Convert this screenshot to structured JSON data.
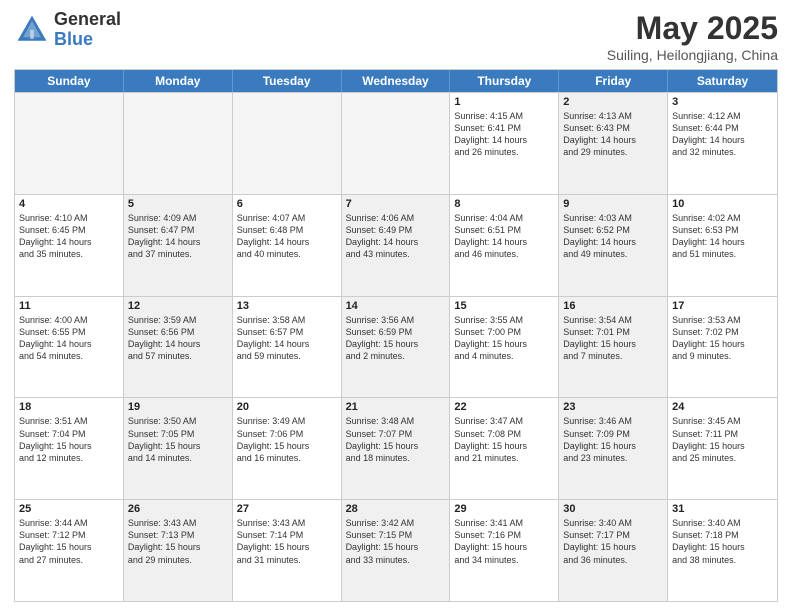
{
  "header": {
    "logo_general": "General",
    "logo_blue": "Blue",
    "month": "May 2025",
    "location": "Suiling, Heilongjiang, China"
  },
  "weekdays": [
    "Sunday",
    "Monday",
    "Tuesday",
    "Wednesday",
    "Thursday",
    "Friday",
    "Saturday"
  ],
  "weeks": [
    [
      {
        "day": "",
        "info": "",
        "empty": true
      },
      {
        "day": "",
        "info": "",
        "empty": true
      },
      {
        "day": "",
        "info": "",
        "empty": true
      },
      {
        "day": "",
        "info": "",
        "empty": true
      },
      {
        "day": "1",
        "info": "Sunrise: 4:15 AM\nSunset: 6:41 PM\nDaylight: 14 hours\nand 26 minutes."
      },
      {
        "day": "2",
        "info": "Sunrise: 4:13 AM\nSunset: 6:43 PM\nDaylight: 14 hours\nand 29 minutes.",
        "shaded": true
      },
      {
        "day": "3",
        "info": "Sunrise: 4:12 AM\nSunset: 6:44 PM\nDaylight: 14 hours\nand 32 minutes."
      }
    ],
    [
      {
        "day": "4",
        "info": "Sunrise: 4:10 AM\nSunset: 6:45 PM\nDaylight: 14 hours\nand 35 minutes."
      },
      {
        "day": "5",
        "info": "Sunrise: 4:09 AM\nSunset: 6:47 PM\nDaylight: 14 hours\nand 37 minutes.",
        "shaded": true
      },
      {
        "day": "6",
        "info": "Sunrise: 4:07 AM\nSunset: 6:48 PM\nDaylight: 14 hours\nand 40 minutes."
      },
      {
        "day": "7",
        "info": "Sunrise: 4:06 AM\nSunset: 6:49 PM\nDaylight: 14 hours\nand 43 minutes.",
        "shaded": true
      },
      {
        "day": "8",
        "info": "Sunrise: 4:04 AM\nSunset: 6:51 PM\nDaylight: 14 hours\nand 46 minutes."
      },
      {
        "day": "9",
        "info": "Sunrise: 4:03 AM\nSunset: 6:52 PM\nDaylight: 14 hours\nand 49 minutes.",
        "shaded": true
      },
      {
        "day": "10",
        "info": "Sunrise: 4:02 AM\nSunset: 6:53 PM\nDaylight: 14 hours\nand 51 minutes."
      }
    ],
    [
      {
        "day": "11",
        "info": "Sunrise: 4:00 AM\nSunset: 6:55 PM\nDaylight: 14 hours\nand 54 minutes."
      },
      {
        "day": "12",
        "info": "Sunrise: 3:59 AM\nSunset: 6:56 PM\nDaylight: 14 hours\nand 57 minutes.",
        "shaded": true
      },
      {
        "day": "13",
        "info": "Sunrise: 3:58 AM\nSunset: 6:57 PM\nDaylight: 14 hours\nand 59 minutes."
      },
      {
        "day": "14",
        "info": "Sunrise: 3:56 AM\nSunset: 6:59 PM\nDaylight: 15 hours\nand 2 minutes.",
        "shaded": true
      },
      {
        "day": "15",
        "info": "Sunrise: 3:55 AM\nSunset: 7:00 PM\nDaylight: 15 hours\nand 4 minutes."
      },
      {
        "day": "16",
        "info": "Sunrise: 3:54 AM\nSunset: 7:01 PM\nDaylight: 15 hours\nand 7 minutes.",
        "shaded": true
      },
      {
        "day": "17",
        "info": "Sunrise: 3:53 AM\nSunset: 7:02 PM\nDaylight: 15 hours\nand 9 minutes."
      }
    ],
    [
      {
        "day": "18",
        "info": "Sunrise: 3:51 AM\nSunset: 7:04 PM\nDaylight: 15 hours\nand 12 minutes."
      },
      {
        "day": "19",
        "info": "Sunrise: 3:50 AM\nSunset: 7:05 PM\nDaylight: 15 hours\nand 14 minutes.",
        "shaded": true
      },
      {
        "day": "20",
        "info": "Sunrise: 3:49 AM\nSunset: 7:06 PM\nDaylight: 15 hours\nand 16 minutes."
      },
      {
        "day": "21",
        "info": "Sunrise: 3:48 AM\nSunset: 7:07 PM\nDaylight: 15 hours\nand 18 minutes.",
        "shaded": true
      },
      {
        "day": "22",
        "info": "Sunrise: 3:47 AM\nSunset: 7:08 PM\nDaylight: 15 hours\nand 21 minutes."
      },
      {
        "day": "23",
        "info": "Sunrise: 3:46 AM\nSunset: 7:09 PM\nDaylight: 15 hours\nand 23 minutes.",
        "shaded": true
      },
      {
        "day": "24",
        "info": "Sunrise: 3:45 AM\nSunset: 7:11 PM\nDaylight: 15 hours\nand 25 minutes."
      }
    ],
    [
      {
        "day": "25",
        "info": "Sunrise: 3:44 AM\nSunset: 7:12 PM\nDaylight: 15 hours\nand 27 minutes."
      },
      {
        "day": "26",
        "info": "Sunrise: 3:43 AM\nSunset: 7:13 PM\nDaylight: 15 hours\nand 29 minutes.",
        "shaded": true
      },
      {
        "day": "27",
        "info": "Sunrise: 3:43 AM\nSunset: 7:14 PM\nDaylight: 15 hours\nand 31 minutes."
      },
      {
        "day": "28",
        "info": "Sunrise: 3:42 AM\nSunset: 7:15 PM\nDaylight: 15 hours\nand 33 minutes.",
        "shaded": true
      },
      {
        "day": "29",
        "info": "Sunrise: 3:41 AM\nSunset: 7:16 PM\nDaylight: 15 hours\nand 34 minutes."
      },
      {
        "day": "30",
        "info": "Sunrise: 3:40 AM\nSunset: 7:17 PM\nDaylight: 15 hours\nand 36 minutes.",
        "shaded": true
      },
      {
        "day": "31",
        "info": "Sunrise: 3:40 AM\nSunset: 7:18 PM\nDaylight: 15 hours\nand 38 minutes."
      }
    ]
  ]
}
